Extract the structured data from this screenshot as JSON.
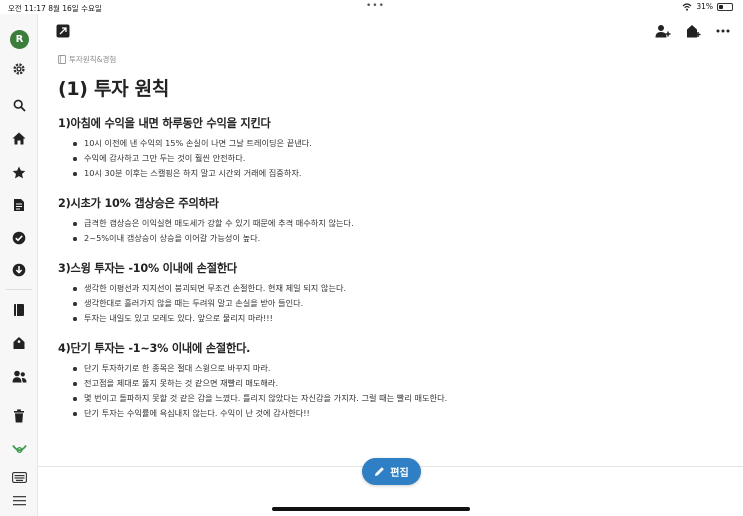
{
  "status_bar": {
    "time": "오전 11:17",
    "date": "8월 16일 수요일",
    "dots": "•••",
    "battery_percent": "31%",
    "battery_level": 0.31
  },
  "sidebar": {
    "avatar_letter": "R",
    "avatar_color": "#3b7d3b",
    "icons": [
      "gear-icon",
      "search-icon",
      "home-icon",
      "star-icon",
      "note-icon",
      "check-circle-icon",
      "download-icon",
      "notebook-icon",
      "tag-icon",
      "people-icon",
      "trash-icon",
      "horn-icon",
      "keyboard-icon",
      "menu-icon"
    ]
  },
  "toolbar": {
    "expand_icon": "expand-icon",
    "right_icons": [
      "add-user-icon",
      "reminder-icon",
      "more-icon"
    ]
  },
  "note": {
    "breadcrumb": "투자원칙&경험",
    "title": "(1) 투자 원칙",
    "sections": [
      {
        "heading": "1)아침에 수익을 내면 하루동안 수익을 지킨다",
        "bullets": [
          "10시 이전에 낸 수익의 15% 손실이 나면 그날 트레이딩은 끝낸다.",
          "수익에 감사하고 그만 두는 것이 훨씬 안전하다.",
          "10시 30분 이후는 스캘핑은 하지 말고 시간외 거래에 집중하자."
        ]
      },
      {
        "heading": "2)시초가 10% 갭상승은 주의하라",
        "bullets": [
          "급격한 갭상승은 이익실현 매도세가 강할 수 있기 때문에 추격 매수하지 않는다.",
          "2~5%이내 갭상승이 상승을 이어갈 가능성이 높다."
        ]
      },
      {
        "heading": "3)스윙 투자는 -10% 이내에 손절한다",
        "bullets": [
          "생각한 이평선과 지지선이 붕괴되면 무조건 손절한다. 현재 제일 되지 않는다.",
          "생각한대로 흘러가지 않을 때는 두려워 말고 손실을 받아 들인다.",
          "투자는 내일도 있고 모레도 있다. 앞으로 물리지 마라!!!"
        ]
      },
      {
        "heading": "4)단기 투자는 -1~3% 이내에 손절한다.",
        "bullets": [
          "단기 투자하기로 한 종목은 절대 스윙으로 바꾸지 마라.",
          "전고점을 제대로 뚫지 못하는 것 같으면 재빨리 매도해라.",
          "몇 번이고 돌파하지 못할 것 같은 감을 느꼈다. 틀리지 않았다는 자신감을 가지자. 그럴 때는 빨리 매도한다.",
          "단기 투자는 수익률에 욕심내지 않는다. 수익이 난 것에 감사한다!!"
        ]
      }
    ]
  },
  "edit_button": {
    "label": "편집",
    "color": "#2f7fc4"
  }
}
